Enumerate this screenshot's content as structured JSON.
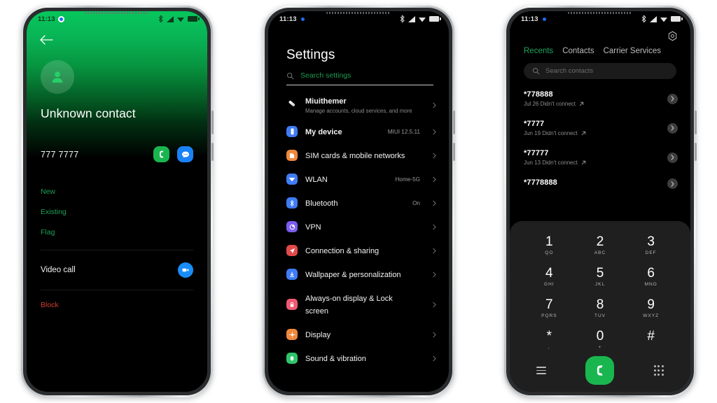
{
  "statusbar": {
    "time": "11:13",
    "icons": [
      "bluetooth-icon",
      "signal-icon",
      "wifi-icon",
      "battery-icon"
    ]
  },
  "phone1": {
    "back_icon": "back-arrow-icon",
    "avatar_icon": "person-avatar-icon",
    "contact_name": "Unknown contact",
    "phone_number": "777 7777",
    "call_icon": "phone-call-icon",
    "message_icon": "message-bubble-icon",
    "links": [
      "New",
      "Existing",
      "Flag"
    ],
    "video_call_label": "Video call",
    "video_icon": "video-camera-icon",
    "block_label": "Block",
    "colors": {
      "accent_green": "#07c65c",
      "link_green": "#1fa05a",
      "block_red": "#d13b2f",
      "blue": "#1a82f7"
    }
  },
  "phone2": {
    "title": "Settings",
    "search_placeholder": "Search settings",
    "search_icon": "search-icon",
    "items": [
      {
        "label": "Miuithemer",
        "sub": "Manage accounts, cloud services, and more",
        "value": "",
        "icon": "mi-account-icon",
        "color": "#ffffff"
      },
      {
        "label": "My device",
        "sub": "",
        "value": "MIUI 12.5.11",
        "icon": "device-icon",
        "color": "#3f7cf6"
      },
      {
        "label": "SIM cards & mobile networks",
        "sub": "",
        "value": "",
        "icon": "sim-card-icon",
        "color": "#f0883c"
      },
      {
        "label": "WLAN",
        "sub": "",
        "value": "Home-5G",
        "icon": "wifi-icon",
        "color": "#3f7cf6"
      },
      {
        "label": "Bluetooth",
        "sub": "",
        "value": "On",
        "icon": "bluetooth-icon",
        "color": "#3f7cf6"
      },
      {
        "label": "VPN",
        "sub": "",
        "value": "",
        "icon": "vpn-icon",
        "color": "#7a5cf0"
      },
      {
        "label": "Connection & sharing",
        "sub": "",
        "value": "",
        "icon": "share-icon",
        "color": "#e14a4a"
      },
      {
        "label": "Wallpaper & personalization",
        "sub": "",
        "value": "",
        "icon": "wallpaper-icon",
        "color": "#3f7cf6"
      },
      {
        "label": "Always-on display & Lock screen",
        "sub": "",
        "value": "",
        "icon": "lock-screen-icon",
        "color": "#ef5a72"
      },
      {
        "label": "Display",
        "sub": "",
        "value": "",
        "icon": "display-icon",
        "color": "#f0883c"
      },
      {
        "label": "Sound & vibration",
        "sub": "",
        "value": "",
        "icon": "sound-icon",
        "color": "#2fc46b"
      }
    ]
  },
  "phone3": {
    "gear_icon": "settings-gear-icon",
    "tabs": [
      {
        "label": "Recents",
        "active": true
      },
      {
        "label": "Contacts",
        "active": false
      },
      {
        "label": "Carrier Services",
        "active": false
      }
    ],
    "search_placeholder": "Search contacts",
    "search_icon": "search-icon",
    "calls": [
      {
        "number": "*778888",
        "meta": "Jul 26 Didn't connect",
        "direction_icon": "outgoing-call-icon"
      },
      {
        "number": "*7777",
        "meta": "Jun 19 Didn't connect",
        "direction_icon": "outgoing-call-icon"
      },
      {
        "number": "*77777",
        "meta": "Jun 13 Didn't connect",
        "direction_icon": "outgoing-call-icon"
      },
      {
        "number": "*7778888",
        "meta": "",
        "direction_icon": "outgoing-call-icon"
      }
    ],
    "dialpad": {
      "keys": [
        {
          "digit": "1",
          "letters": "QO"
        },
        {
          "digit": "2",
          "letters": "ABC"
        },
        {
          "digit": "3",
          "letters": "DEF"
        },
        {
          "digit": "4",
          "letters": "GHI"
        },
        {
          "digit": "5",
          "letters": "JKL"
        },
        {
          "digit": "6",
          "letters": "MNO"
        },
        {
          "digit": "7",
          "letters": "PQRS"
        },
        {
          "digit": "8",
          "letters": "TUV"
        },
        {
          "digit": "9",
          "letters": "WXYZ"
        },
        {
          "digit": "*",
          "letters": ","
        },
        {
          "digit": "0",
          "letters": "+"
        },
        {
          "digit": "#",
          "letters": ""
        }
      ],
      "menu_icon": "hamburger-menu-icon",
      "call_icon": "phone-call-icon",
      "keypad_icon": "keypad-grid-icon",
      "call_button_color": "#19b64f"
    }
  }
}
